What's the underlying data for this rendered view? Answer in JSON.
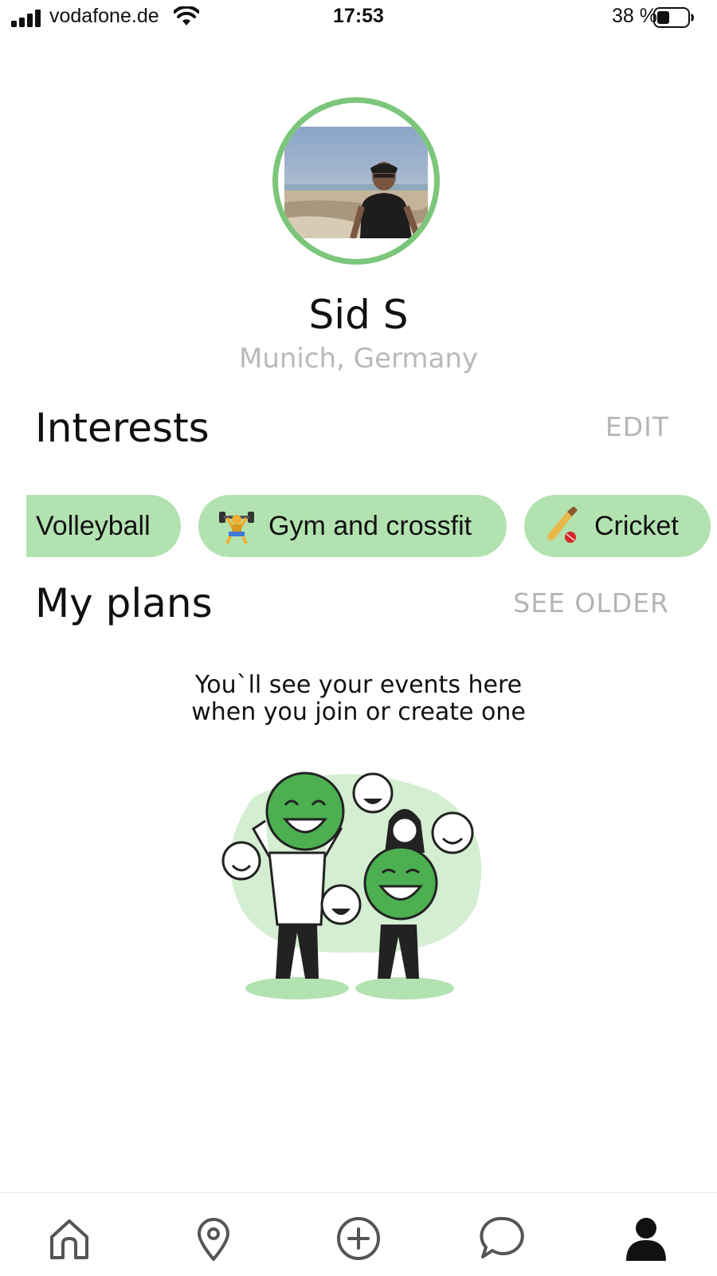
{
  "status_bar": {
    "carrier": "vodafone.de",
    "time": "17:53",
    "battery": "38 %"
  },
  "profile": {
    "name": "Sid S",
    "location": "Munich, Germany"
  },
  "interests": {
    "title": "Interests",
    "edit_label": "EDIT",
    "chips": [
      {
        "label": "Volleyball"
      },
      {
        "label": "Gym and crossfit",
        "icon": "weightlifter-icon"
      },
      {
        "label": "Cricket",
        "icon": "cricket-bat-icon"
      }
    ]
  },
  "plans": {
    "title": "My plans",
    "see_older_label": "SEE OLDER",
    "empty_line1": "You`ll see your events here",
    "empty_line2": "when you join or create one"
  },
  "tab_bar": {
    "tabs": [
      {
        "icon": "home-icon"
      },
      {
        "icon": "location-pin-icon"
      },
      {
        "icon": "plus-circle-icon"
      },
      {
        "icon": "chat-bubble-icon"
      },
      {
        "icon": "profile-icon",
        "active": true
      }
    ]
  },
  "colors": {
    "accent_green": "#7bc67b",
    "chip_green": "#b2e2b0",
    "muted_text": "#b5b5b5"
  }
}
